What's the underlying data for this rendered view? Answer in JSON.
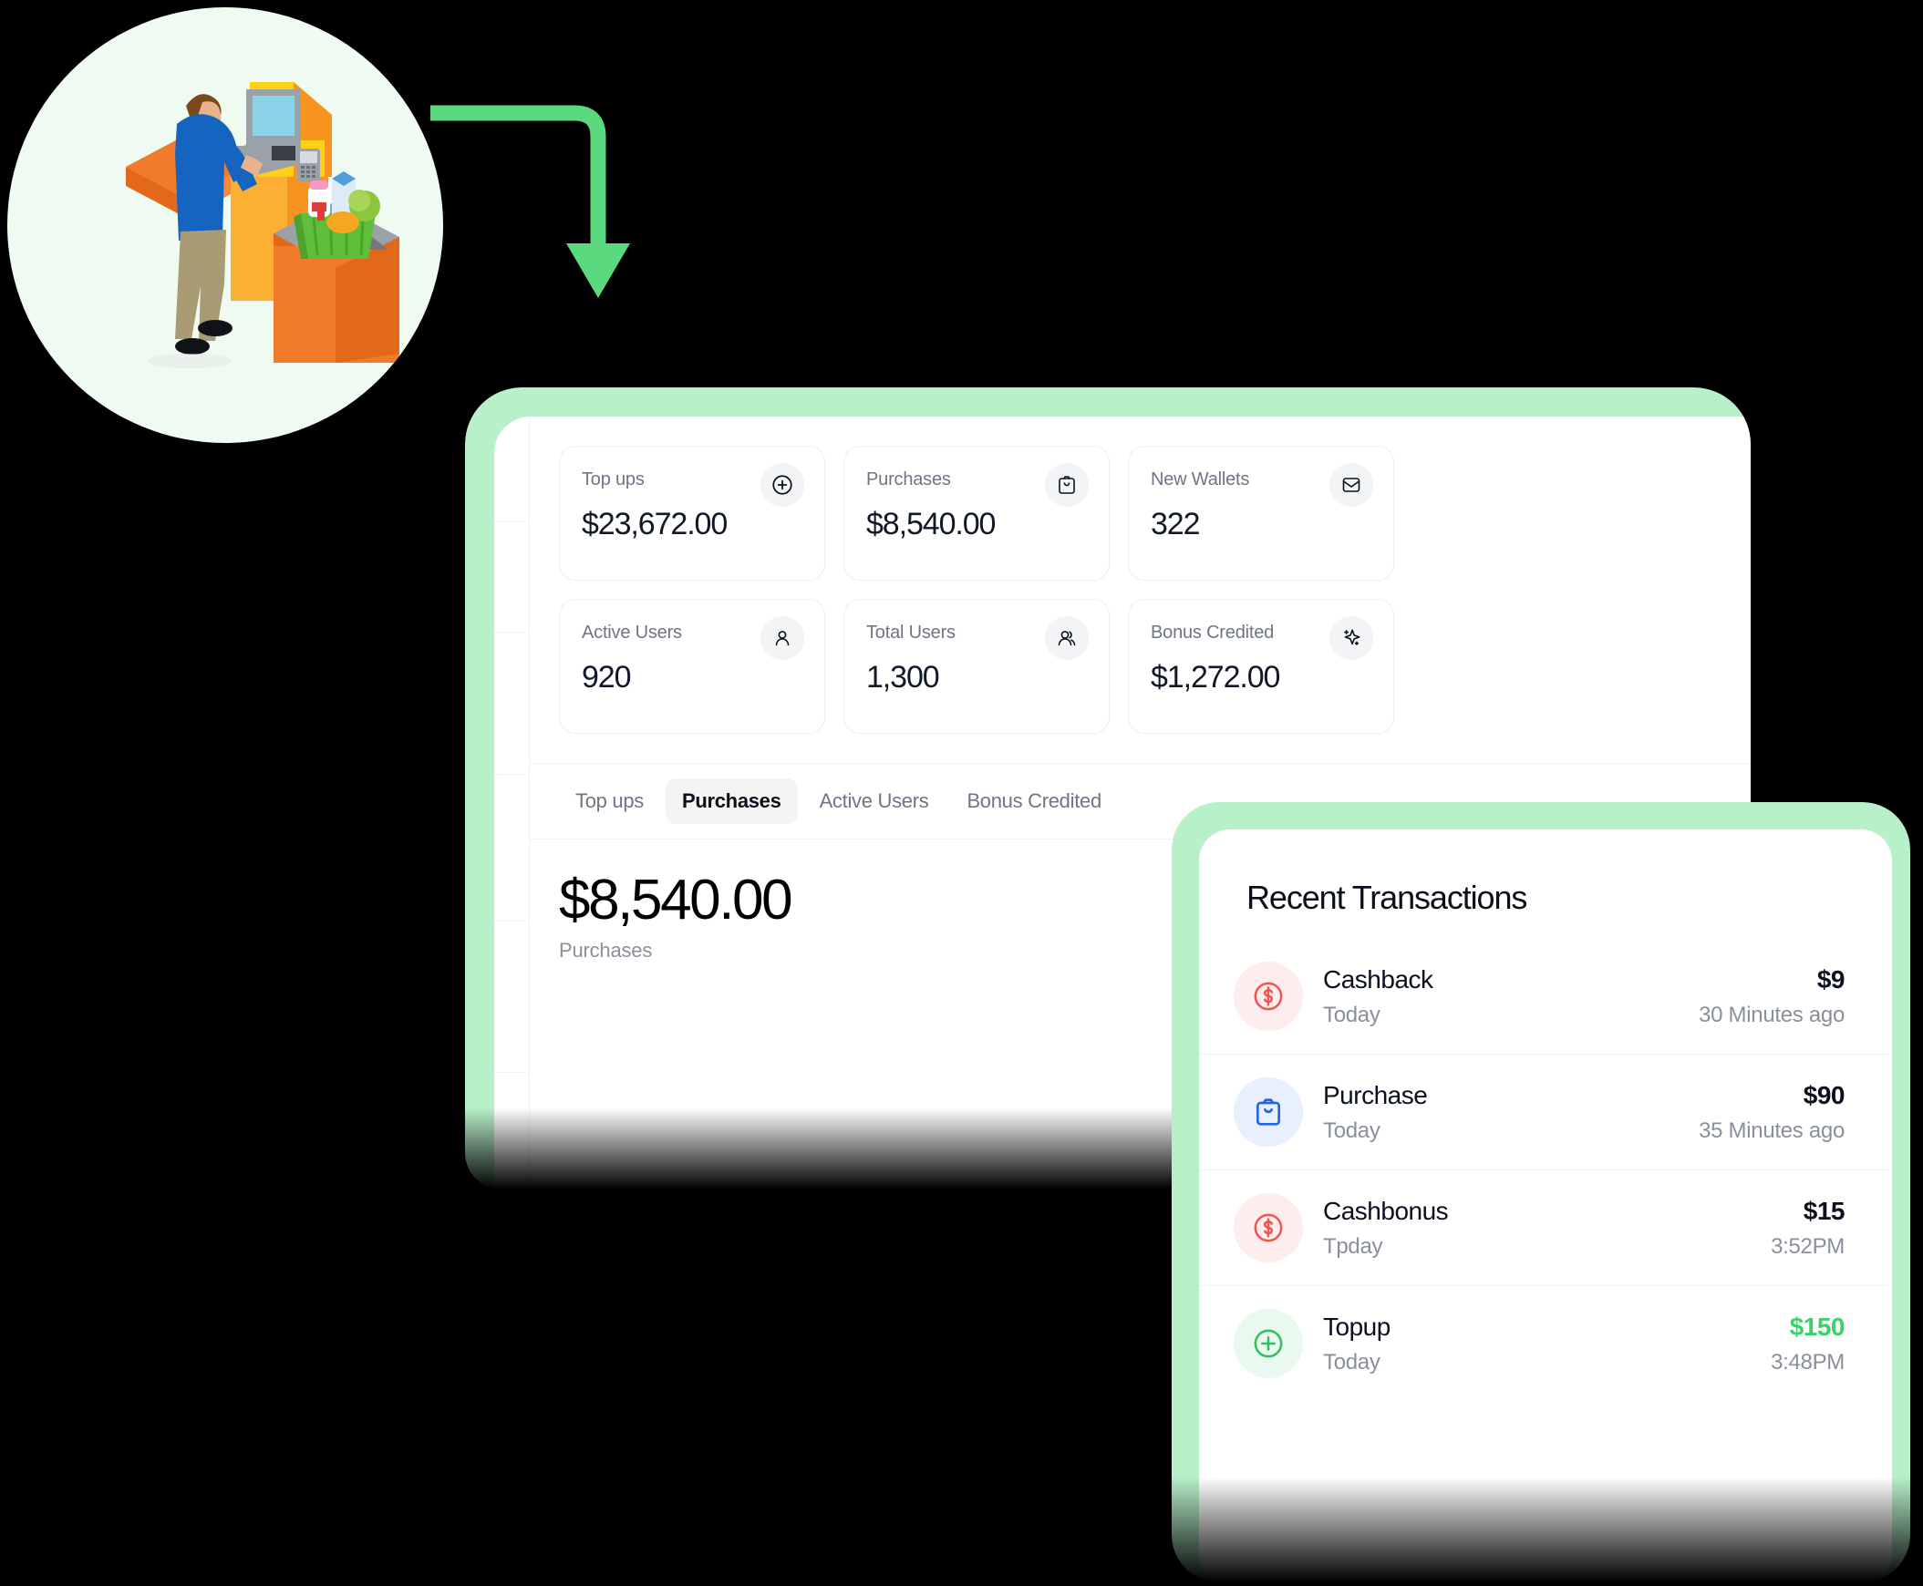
{
  "theme": {
    "accent_green": "#5BD97E",
    "frame_green": "#B8F0CA",
    "bubble_bg": "#EFFAF1",
    "text_dark": "#0B1020",
    "text_muted": "#8A8F9C",
    "positive_green": "#3FCF6B",
    "red_icon": "#F0544F",
    "blue_icon": "#2563EB"
  },
  "illustration": {
    "name": "self-checkout-kiosk-illustration",
    "alt": "Person using a self-checkout kiosk with a basket of groceries"
  },
  "dashboard": {
    "stats": [
      {
        "label": "Top ups",
        "value": "$23,672.00",
        "icon": "plus-circle-icon"
      },
      {
        "label": "Purchases",
        "value": "$8,540.00",
        "icon": "shopping-bag-icon"
      },
      {
        "label": "New Wallets",
        "value": "322",
        "icon": "wallet-icon"
      },
      {
        "label": "Active Users",
        "value": "920",
        "icon": "user-icon"
      },
      {
        "label": "Total Users",
        "value": "1,300",
        "icon": "users-icon"
      },
      {
        "label": "Bonus Credited",
        "value": "$1,272.00",
        "icon": "sparkle-icon"
      }
    ],
    "tabs": [
      {
        "label": "Top ups",
        "active": false
      },
      {
        "label": "Purchases",
        "active": true
      },
      {
        "label": "Active Users",
        "active": false
      },
      {
        "label": "Bonus Credited",
        "active": false
      }
    ],
    "headline": {
      "value": "$8,540.00",
      "caption": "Purchases"
    }
  },
  "transactions": {
    "title": "Recent Transactions",
    "rows": [
      {
        "name": "Cashback",
        "date": "Today",
        "amount": "$9",
        "time": "30 Minutes ago",
        "icon": "dollar-circle-icon",
        "tone": "red",
        "positive": false
      },
      {
        "name": "Purchase",
        "date": "Today",
        "amount": "$90",
        "time": "35 Minutes ago",
        "icon": "shopping-bag-icon",
        "tone": "blue",
        "positive": false
      },
      {
        "name": "Cashbonus",
        "date": "Tpday",
        "amount": "$15",
        "time": "3:52PM",
        "icon": "dollar-circle-icon",
        "tone": "red",
        "positive": false
      },
      {
        "name": "Topup",
        "date": "Today",
        "amount": "$150",
        "time": "3:48PM",
        "icon": "plus-circle-icon",
        "tone": "green",
        "positive": true
      }
    ]
  }
}
